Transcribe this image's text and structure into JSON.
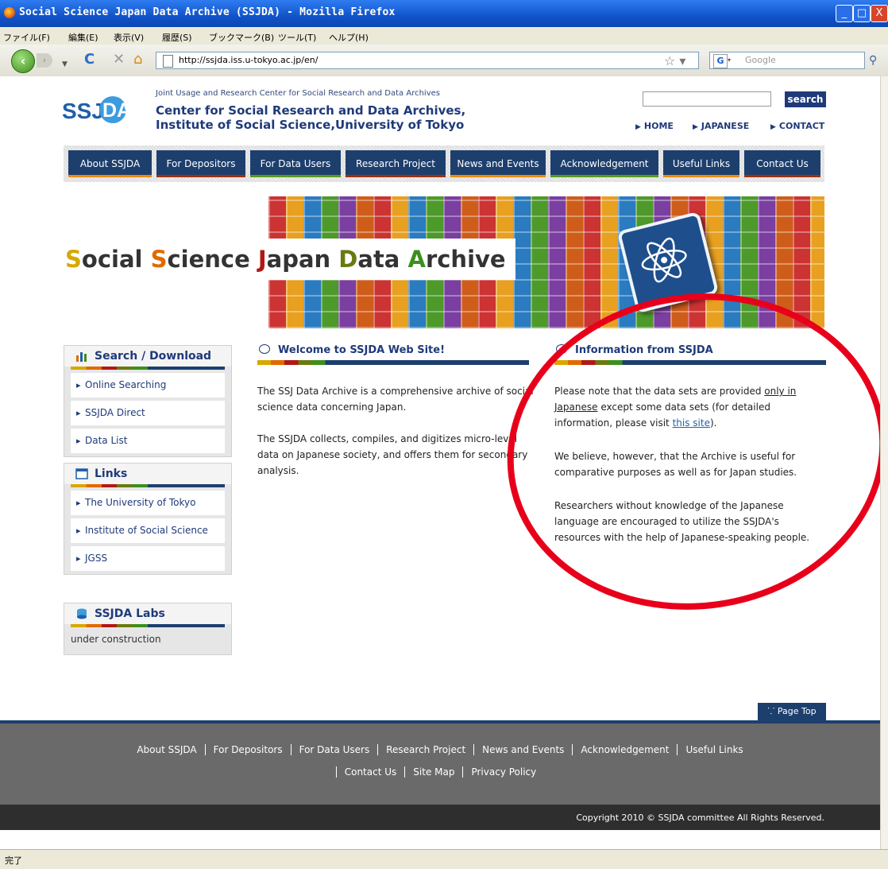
{
  "window": {
    "title": "Social Science Japan Data Archive (SSJDA) - Mozilla Firefox",
    "controls": [
      "_",
      "□",
      "X"
    ]
  },
  "menubar": [
    "ファイル(F)",
    "編集(E)",
    "表示(V)",
    "履歴(S)",
    "ブックマーク(B)",
    "ツール(T)",
    "ヘルプ(H)"
  ],
  "navbar": {
    "url": "http://ssjda.iss.u-tokyo.ac.jp/en/",
    "search_engine": "Google"
  },
  "header": {
    "logo_text": "SSJDA",
    "subtitle": "Joint Usage and Research Center for Social Research and Data Archives",
    "title_line1": "Center for Social Research and Data Archives,",
    "title_line2": "Institute of Social Science,University of Tokyo",
    "search_button": "search",
    "links": [
      "HOME",
      "JAPANESE",
      "CONTACT"
    ]
  },
  "global_nav": [
    "About SSJDA",
    "For Depositors",
    "For Data Users",
    "Research Project",
    "News and Events",
    "Acknowledgement",
    "Useful Links",
    "Contact Us"
  ],
  "banner": {
    "title_parts": [
      "S",
      "ocial ",
      "S",
      "cience ",
      "J",
      "apan ",
      "D",
      "ata ",
      "A",
      "rchive"
    ]
  },
  "sidebar": {
    "search_download": {
      "title": "Search / Download",
      "items": [
        "Online Searching",
        "SSJDA Direct",
        "Data List"
      ]
    },
    "links": {
      "title": "Links",
      "items": [
        "The University of Tokyo",
        "Institute of Social Science",
        "JGSS"
      ]
    },
    "labs": {
      "title": "SSJDA Labs",
      "text": "under construction"
    }
  },
  "welcome": {
    "title": "Welcome to SSJDA Web Site!",
    "p1": "The SSJ Data Archive is a comprehensive archive of social science data concerning Japan.",
    "p2": "The SSJDA collects, compiles, and digitizes micro-level data on Japanese society, and offers them for secondary analysis."
  },
  "information": {
    "title": "Information from SSJDA",
    "p1_a": "Please note that the data sets are provided ",
    "p1_link1": "only in Japanese",
    "p1_b": " except some data sets (for detailed information, please visit ",
    "p1_link2": "this site",
    "p1_c": ").",
    "p2": "We believe, however, that the Archive is useful for comparative purposes as well as for Japan studies.",
    "p3": "Researchers without knowledge of the Japanese language are encouraged to utilize the SSJDA's resources with the help of Japanese-speaking people."
  },
  "page_top": "Page Top",
  "footer": {
    "row1": [
      "About SSJDA",
      "For Depositors",
      "For Data Users",
      "Research Project",
      "News and Events",
      "Acknowledgement",
      "Useful Links"
    ],
    "row2": [
      "Contact Us",
      "Site Map",
      "Privacy Policy"
    ],
    "copyright": "Copyright 2010 © SSJDA committee All Rights Reserved."
  },
  "status": "完了",
  "colors": {
    "navy": "#1d3f6e",
    "annotation_red": "#e8001b"
  }
}
